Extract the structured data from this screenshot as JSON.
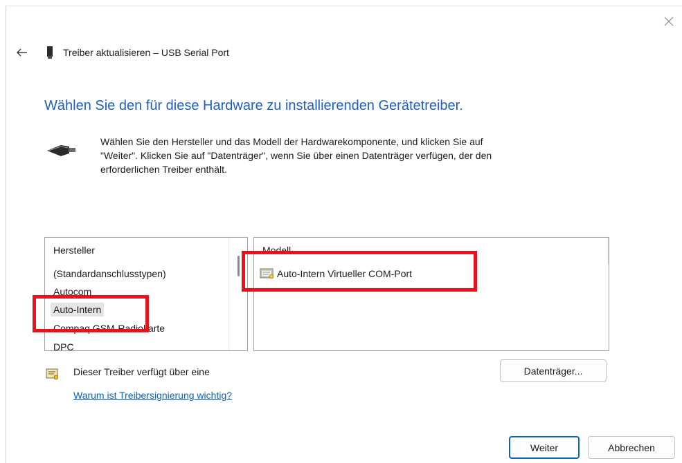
{
  "window": {
    "title": "Treiber aktualisieren – USB Serial Port",
    "close_icon": "close-icon",
    "back_icon": "back-arrow-icon"
  },
  "heading": "Wählen Sie den für diese Hardware zu installierenden Gerätetreiber.",
  "instructions": "Wählen Sie den Hersteller und das Modell der Hardwarekomponente, und klicken Sie auf\n\"Weiter\". Klicken Sie auf \"Datenträger\", wenn Sie über einen Datenträger verfügen, der den\nerforderlichen Treiber enthält.",
  "hersteller_list": {
    "header": "Hersteller",
    "items": [
      "(Standardanschlusstypen)",
      "Autocom",
      "Auto-Intern",
      "Compaq GSM-Radiokarte",
      "DPC"
    ],
    "selected": "Auto-Intern"
  },
  "modell_list": {
    "header": "Modell",
    "items": [
      "Auto-Intern Virtueller COM-Port"
    ]
  },
  "signature": {
    "text": "Dieser Treiber verfügt über eine",
    "link": "Warum ist Treibersignierung wichtig?"
  },
  "buttons": {
    "datentraeger": "Datenträger...",
    "weiter": "Weiter",
    "abbrechen": "Abbrechen"
  },
  "colors": {
    "heading": "#1f5fbf",
    "link": "#0b63c1",
    "highlight_box": "#e8121e",
    "primary_border": "#0a64c8"
  }
}
